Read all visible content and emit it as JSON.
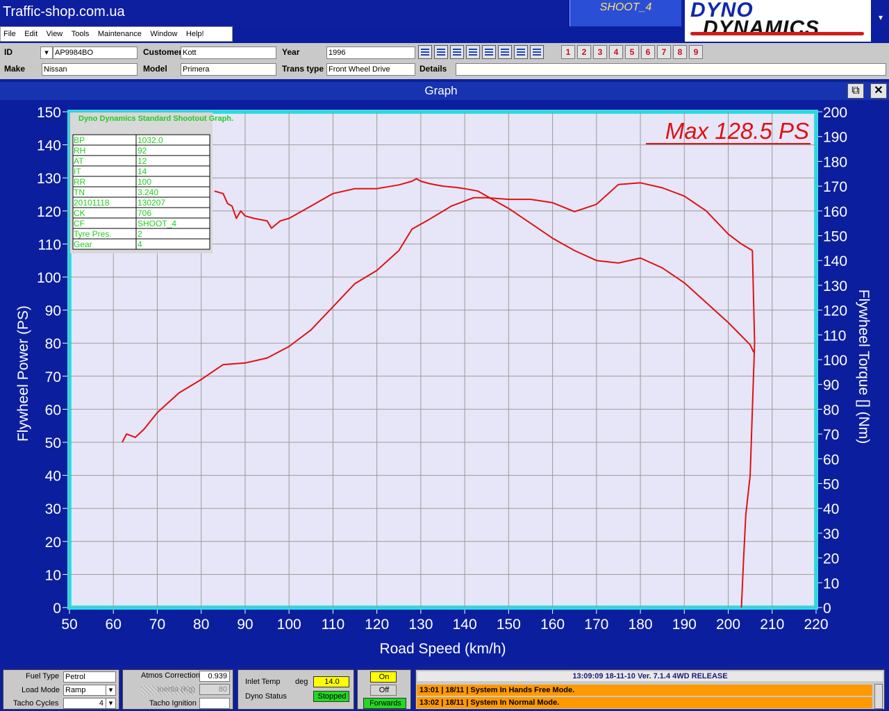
{
  "window": {
    "site_title": "Traffic-shop.com.ua",
    "shoot_label": "SHOOT_4",
    "logo_line1": "DYNO",
    "logo_line2": "DYNAMICS",
    "corner_icon": "chevron-down-icon"
  },
  "menu": [
    "File",
    "Edit",
    "View",
    "Tools",
    "Maintenance",
    "Window",
    "Help!"
  ],
  "info": {
    "id_label": "ID",
    "id_value": "AP9984BO",
    "customer_label": "Customer",
    "customer_value": "Kott",
    "year_label": "Year",
    "year_value": "1996",
    "make_label": "Make",
    "make_value": "Nissan",
    "model_label": "Model",
    "model_value": "Primera",
    "trans_label": "Trans type",
    "trans_value": "Front Wheel Drive",
    "details_label": "Details",
    "details_value": ""
  },
  "toolbar_icons": [
    "table-icon",
    "curve-icon",
    "grid-icon",
    "dyno-icon",
    "report-icon",
    "layout-icon",
    "line-icon",
    "print-icon"
  ],
  "run_buttons": [
    "1",
    "2",
    "3",
    "4",
    "5",
    "6",
    "7",
    "8",
    "9"
  ],
  "graph_window": {
    "title": "Graph",
    "restore_icon": "restore-icon",
    "close_icon": "close-icon"
  },
  "chart_data": {
    "type": "line",
    "xlabel": "Road Speed (km/h)",
    "ylabel": "Flywheel Power (PS)",
    "y2label": "Flywheel Torque [] (Nm)",
    "xlim": [
      50,
      220
    ],
    "ylim": [
      0,
      150
    ],
    "y2lim": [
      0,
      200
    ],
    "xticks": [
      "50",
      "60",
      "70",
      "80",
      "90",
      "100",
      "110",
      "120",
      "130",
      "140",
      "150",
      "160",
      "170",
      "180",
      "190",
      "200",
      "210",
      "220"
    ],
    "yticks": [
      "0",
      "10",
      "20",
      "30",
      "40",
      "50",
      "60",
      "70",
      "80",
      "90",
      "100",
      "110",
      "120",
      "130",
      "140",
      "150"
    ],
    "y2ticks": [
      "0",
      "10",
      "20",
      "30",
      "40",
      "50",
      "60",
      "70",
      "80",
      "90",
      "100",
      "110",
      "120",
      "130",
      "140",
      "150",
      "160",
      "170",
      "180",
      "190",
      "200"
    ],
    "grid": true,
    "annotation": "Max 128.5 PS",
    "series": [
      {
        "color": "#e01010",
        "axis": "left",
        "x": [
          62,
          63,
          65,
          67,
          70,
          75,
          80,
          85,
          90,
          95,
          100,
          105,
          110,
          115,
          120,
          125,
          128,
          132,
          137,
          142,
          145,
          150,
          155,
          160,
          165,
          170,
          175,
          180,
          185,
          190,
          195,
          200,
          203,
          205.5,
          206,
          205.5,
          205,
          204,
          203.5,
          203
        ],
        "y": [
          50,
          52.5,
          51.5,
          54,
          59,
          65,
          69,
          73.5,
          74,
          75.5,
          79,
          84,
          91,
          98,
          102,
          108,
          114.5,
          117.5,
          121.5,
          124,
          124,
          123.5,
          123.5,
          122.5,
          119.8,
          122,
          128,
          128.5,
          127,
          124.5,
          120,
          113,
          110,
          108,
          80,
          60,
          40,
          28,
          15,
          0
        ]
      },
      {
        "color": "#e01010",
        "axis": "right",
        "x": [
          83,
          85,
          86,
          87,
          88,
          89,
          90,
          92,
          95,
          96,
          98,
          100,
          105,
          110,
          115,
          120,
          125,
          128,
          129,
          130,
          132,
          135,
          138,
          140,
          143,
          145,
          148,
          150,
          155,
          160,
          165,
          170,
          175,
          180,
          185,
          190,
          195,
          200,
          205,
          205.8
        ],
        "y": [
          168,
          167,
          163,
          162,
          157,
          160,
          158,
          157,
          156,
          153,
          156,
          157,
          162,
          167,
          169,
          169,
          170.5,
          172,
          173,
          172,
          171,
          170,
          169.5,
          169,
          168,
          166,
          163,
          161,
          155,
          149,
          144,
          140,
          139,
          141,
          137,
          131,
          123,
          115,
          106,
          103
        ]
      }
    ],
    "info_box": {
      "title": "Dyno Dynamics Standard Shootout Graph.",
      "rows": [
        [
          "BP",
          "1032.0"
        ],
        [
          "RH",
          "92"
        ],
        [
          "AT",
          "12"
        ],
        [
          "IT",
          "14"
        ],
        [
          "RR",
          "100"
        ],
        [
          "TN",
          "3.240"
        ],
        [
          "20101118",
          "130207"
        ],
        [
          "CK",
          "706"
        ],
        [
          "CF",
          "SHOOT_4"
        ],
        [
          "Tyre Pres.",
          "2"
        ],
        [
          "Gear",
          "4"
        ]
      ]
    }
  },
  "status": {
    "fuel_type_label": "Fuel Type",
    "fuel_type_value": "Petrol",
    "load_mode_label": "Load Mode",
    "load_mode_value": "Ramp",
    "tacho_cycles_label": "Tacho Cycles",
    "tacho_cycles_value": "4",
    "atmos_label": "Atmos Correction",
    "atmos_value": "0.939",
    "dim_label": "Inertia (Kg)",
    "dim_value": "80",
    "tacho_ignition_label": "Tacho Ignition",
    "inlet_label": "Inlet Temp",
    "inlet_unit": "deg",
    "inlet_value": "14.0",
    "dyno_status_label": "Dyno Status",
    "dyno_status_value": "Stopped",
    "on_label": "On",
    "off_label": "Off",
    "direction_label": "Forwards",
    "clock_line": "13:09:09    18-11-10    Ver.  7.1.4 4WD RELEASE",
    "log": [
      "13:01 | 18/11 | System In Hands Free Mode.",
      "13:02 | 18/11 | System In Normal Mode."
    ]
  }
}
